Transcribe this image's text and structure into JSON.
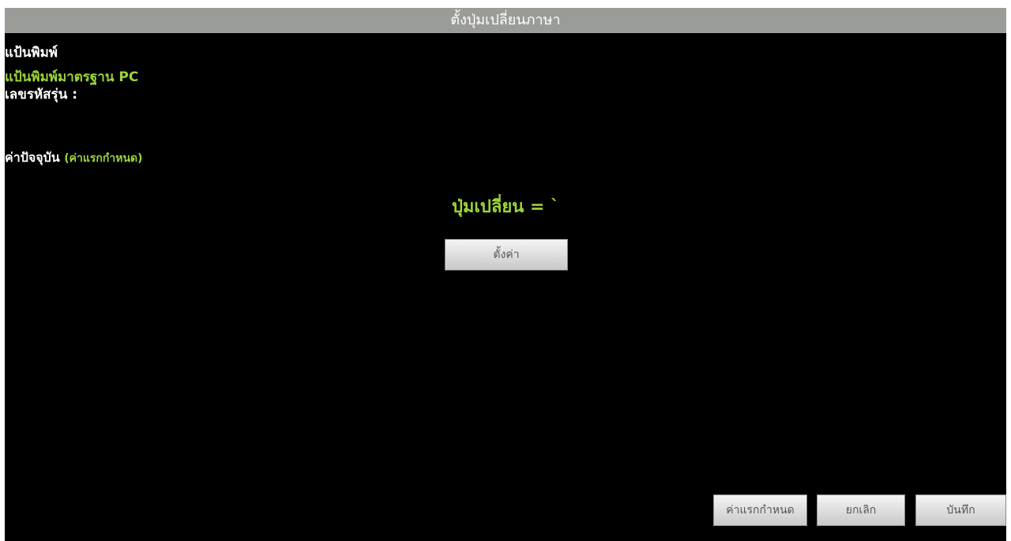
{
  "window": {
    "title": "ตั้งปุ่มเปลี่ยนภาษา"
  },
  "keyboard": {
    "heading": "แป้นพิมพ์",
    "type": "แป้นพิมพ์มาตรฐาน PC",
    "model_label": "เลขรหัสรุ่น :"
  },
  "current": {
    "label": "ค่าปัจจุบัน",
    "default_tag": "(ค่าแรกกำหนด)"
  },
  "switch_key": {
    "display": "ปุ่มเปลี่ยน = `"
  },
  "buttons": {
    "set": "ตั้งค่า",
    "default": "ค่าแรกกำหนด",
    "cancel": "ยกเลิก",
    "save": "บันทึก"
  },
  "colors": {
    "background": "#000000",
    "titlebar": "#9a9c98",
    "accent_green": "#9dd53a",
    "text_white": "#ffffff"
  }
}
